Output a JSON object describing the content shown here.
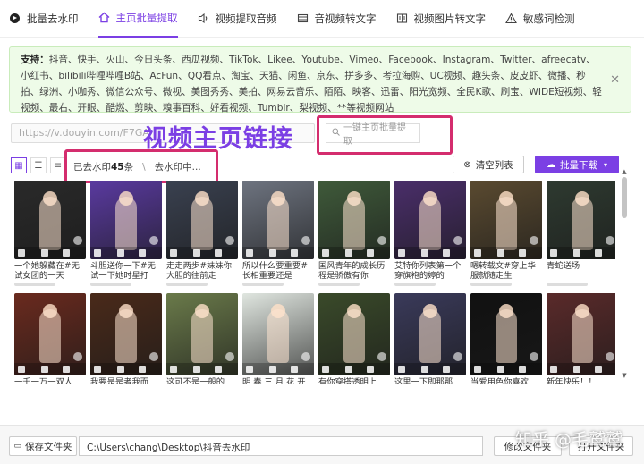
{
  "nav": {
    "items": [
      {
        "label": "批量去水印",
        "icon": "play-circle-icon"
      },
      {
        "label": "主页批量提取",
        "icon": "home-icon",
        "active": true
      },
      {
        "label": "视频提取音频",
        "icon": "speaker-icon"
      },
      {
        "label": "音视频转文字",
        "icon": "film-icon"
      },
      {
        "label": "视频图片转文字",
        "icon": "image-text-icon"
      },
      {
        "label": "敏感词检测",
        "icon": "warning-icon"
      }
    ]
  },
  "support": {
    "label": "支持：",
    "text": "抖音、快手、火山、今日头条、西瓜视频、TikTok、Likee、Youtube、Vimeo、Facebook、Instagram、Twitter、afreecatv、小红书、bilibili哔哩哔哩B站、AcFun、QQ看点、淘宝、天猫、闲鱼、京东、拼多多、考拉海购、UC视频、趣头条、皮皮虾、微播、秒拍、绿洲、小咖秀、微信公众号、微视、美图秀秀、美拍、网易云音乐、陌陌、映客、迅雷、阳光宽频、全民K歌、刷宝、WIDE短视频、轻视频、最右、开眼、酷燃、剪映、糗事百科、好看视频、Tumblr、梨视频、**等视频网站"
  },
  "url_input": {
    "value": "https://v.douyin.com/F7GA"
  },
  "overlay_title": "视频主页链接",
  "search_button": {
    "label": "一键主页批量提取"
  },
  "status": {
    "done_prefix": "已去水印",
    "done_count": "45",
    "done_suffix": "条",
    "sep": "\\",
    "processing": "去水印中..."
  },
  "clear_button": {
    "label": "清空列表"
  },
  "batch_button": {
    "label": "批量下载"
  },
  "videos": [
    {
      "caption": "一个她躲藏在#无试女团的一天",
      "color": "#2a2a2a"
    },
    {
      "caption": "斗胆送你一下#无试一下她时星打",
      "color": "#5a3aa0"
    },
    {
      "caption": "走走两步#妹妹你大胆的往前走",
      "color": "#3a4150"
    },
    {
      "caption": "所以什么要重要#长相重要还是",
      "color": "#6e7480"
    },
    {
      "caption": "国风青年的成长历程是骄傲有你",
      "color": "#3f5a3a"
    },
    {
      "caption": "艾特你列表第一个穿旗袍的婷的",
      "color": "#4a2e6a"
    },
    {
      "caption": "嗯转载文#穿上华服就随走生",
      "color": "#5a4a30"
    },
    {
      "caption": "青蛇送场",
      "color": "#2e3a30"
    },
    {
      "caption": "一千一万一双人",
      "color": "#6a2a1e"
    },
    {
      "caption": "我要是是者我而",
      "color": "#4a2a1a"
    },
    {
      "caption": "这可不是一般的",
      "color": "#6a7a4a"
    },
    {
      "caption": "明 春 三 月 花 开",
      "color": "#e0e6e0"
    },
    {
      "caption": "有你穿搭透明上",
      "color": "#3a4a2a"
    },
    {
      "caption": "这里一下即那那",
      "color": "#3a3a5a"
    },
    {
      "caption": "当爱用色你喜欢",
      "color": "#111111"
    },
    {
      "caption": "新年快乐！！",
      "color": "#5a2a2a"
    }
  ],
  "bottom": {
    "save_label": "保存文件夹",
    "path": "C:\\Users\\chang\\Desktop\\抖音去水印",
    "modify_label": "修改文件夹",
    "open_label": "打开文件夹"
  },
  "watermark": "知乎 @毛鹫鹫"
}
